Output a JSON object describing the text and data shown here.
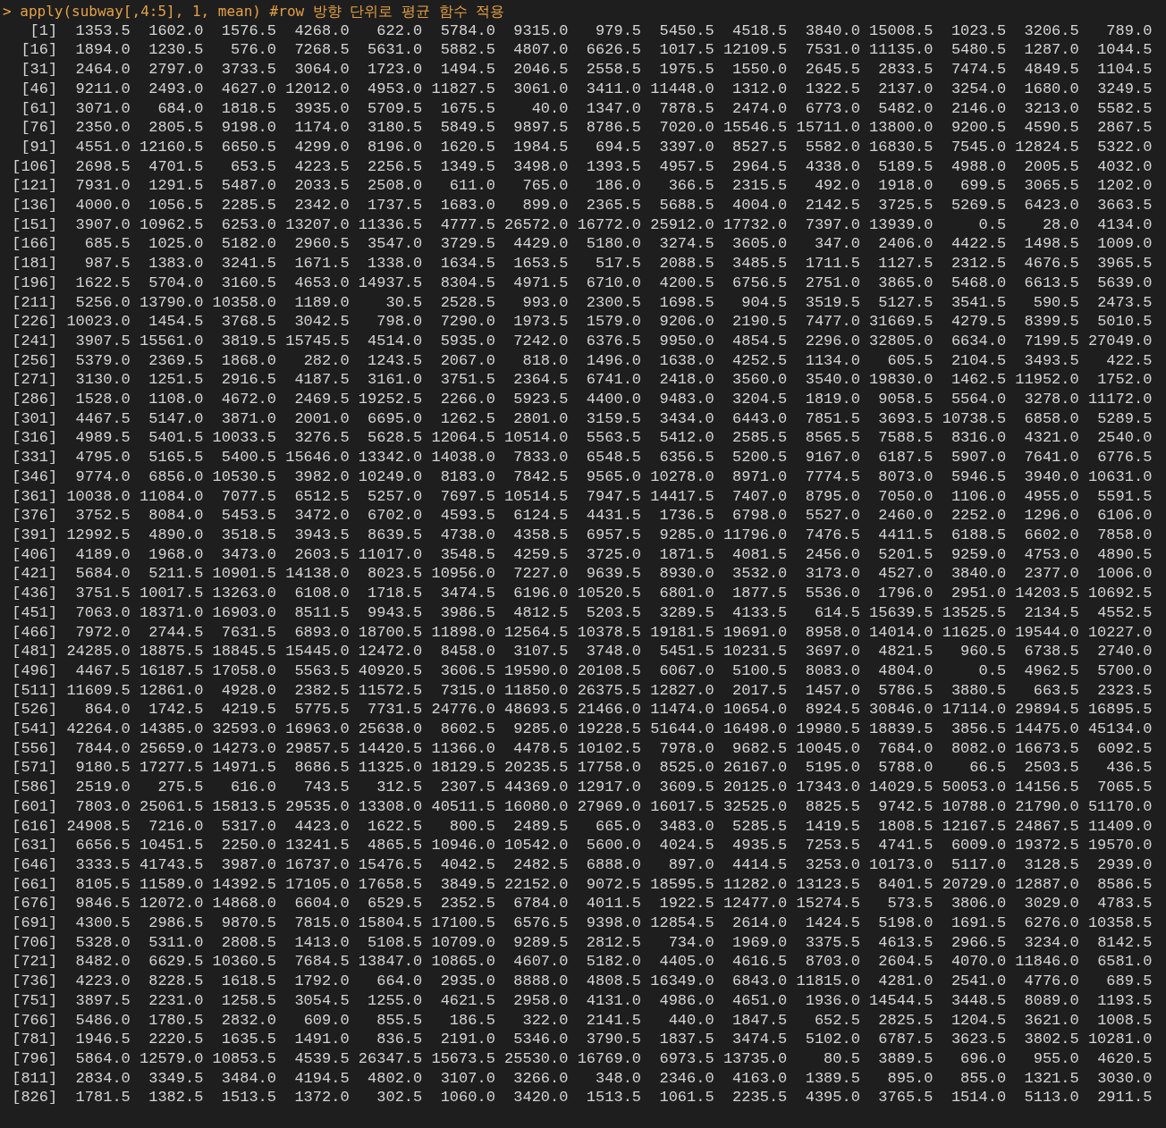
{
  "prompt": "> apply(subway[,4:5], 1, mean) #row 방향 단위로 평균 함수 적용",
  "rows": [
    {
      "index": "[1]",
      "values": [
        "1353.5",
        "1602.0",
        "1576.5",
        "4268.0",
        "622.0",
        "5784.0",
        "9315.0",
        "979.5",
        "5450.5",
        "4518.5",
        "3840.0",
        "15008.5",
        "1023.5",
        "3206.5",
        "789.0"
      ]
    },
    {
      "index": "[16]",
      "values": [
        "1894.0",
        "1230.5",
        "576.0",
        "7268.5",
        "5631.0",
        "5882.5",
        "4807.0",
        "6626.5",
        "1017.5",
        "12109.5",
        "7531.0",
        "11135.0",
        "5480.5",
        "1287.0",
        "1044.5"
      ]
    },
    {
      "index": "[31]",
      "values": [
        "2464.0",
        "2797.0",
        "3733.5",
        "3064.0",
        "1723.0",
        "1494.5",
        "2046.5",
        "2558.5",
        "1975.5",
        "1550.0",
        "2645.5",
        "2833.5",
        "7474.5",
        "4849.5",
        "1104.5"
      ]
    },
    {
      "index": "[46]",
      "values": [
        "9211.0",
        "2493.0",
        "4627.0",
        "12012.0",
        "4953.0",
        "11827.5",
        "3061.0",
        "3411.0",
        "11448.0",
        "1312.0",
        "1322.5",
        "2137.0",
        "3254.0",
        "1680.0",
        "3249.5"
      ]
    },
    {
      "index": "[61]",
      "values": [
        "3071.0",
        "684.0",
        "1818.5",
        "3935.0",
        "5709.5",
        "1675.5",
        "40.0",
        "1347.0",
        "7878.5",
        "2474.0",
        "6773.0",
        "5482.0",
        "2146.0",
        "3213.0",
        "5582.5"
      ]
    },
    {
      "index": "[76]",
      "values": [
        "2350.0",
        "2805.5",
        "9198.0",
        "1174.0",
        "3180.5",
        "5849.5",
        "9897.5",
        "8786.5",
        "7020.0",
        "15546.5",
        "15711.0",
        "13800.0",
        "9200.5",
        "4590.5",
        "2867.5"
      ]
    },
    {
      "index": "[91]",
      "values": [
        "4551.0",
        "12160.5",
        "6650.5",
        "4299.0",
        "8196.0",
        "1620.5",
        "1984.5",
        "694.5",
        "3397.0",
        "8527.5",
        "5582.0",
        "16830.5",
        "7545.0",
        "12824.5",
        "5322.0"
      ]
    },
    {
      "index": "[106]",
      "values": [
        "2698.5",
        "4701.5",
        "653.5",
        "4223.5",
        "2256.5",
        "1349.5",
        "3498.0",
        "1393.5",
        "4957.5",
        "2964.5",
        "4338.0",
        "5189.5",
        "4988.0",
        "2005.5",
        "4032.0"
      ]
    },
    {
      "index": "[121]",
      "values": [
        "7931.0",
        "1291.5",
        "5487.0",
        "2033.5",
        "2508.0",
        "611.0",
        "765.0",
        "186.0",
        "366.5",
        "2315.5",
        "492.0",
        "1918.0",
        "699.5",
        "3065.5",
        "1202.0"
      ]
    },
    {
      "index": "[136]",
      "values": [
        "4000.0",
        "1056.5",
        "2285.5",
        "2342.0",
        "1737.5",
        "1683.0",
        "899.0",
        "2365.5",
        "5688.5",
        "4004.0",
        "2142.5",
        "3725.5",
        "5269.5",
        "6423.0",
        "3663.5"
      ]
    },
    {
      "index": "[151]",
      "values": [
        "3907.0",
        "10962.5",
        "6253.0",
        "13207.0",
        "11336.5",
        "4777.5",
        "26572.0",
        "16772.0",
        "25912.0",
        "17732.0",
        "7397.0",
        "13939.0",
        "0.5",
        "28.0",
        "4134.0"
      ]
    },
    {
      "index": "[166]",
      "values": [
        "685.5",
        "1025.0",
        "5182.0",
        "2960.5",
        "3547.0",
        "3729.5",
        "4429.0",
        "5180.0",
        "3274.5",
        "3605.0",
        "347.0",
        "2406.0",
        "4422.5",
        "1498.5",
        "1009.0"
      ]
    },
    {
      "index": "[181]",
      "values": [
        "987.5",
        "1383.0",
        "3241.5",
        "1671.5",
        "1338.0",
        "1634.5",
        "1653.5",
        "517.5",
        "2088.5",
        "3485.5",
        "1711.5",
        "1127.5",
        "2312.5",
        "4676.5",
        "3965.5"
      ]
    },
    {
      "index": "[196]",
      "values": [
        "1622.5",
        "5704.0",
        "3160.5",
        "4653.0",
        "14937.5",
        "8304.5",
        "4971.5",
        "6710.0",
        "4200.5",
        "6756.5",
        "2751.0",
        "3865.0",
        "5468.0",
        "6613.5",
        "5639.0"
      ]
    },
    {
      "index": "[211]",
      "values": [
        "5256.0",
        "13790.0",
        "10358.0",
        "1189.0",
        "30.5",
        "2528.5",
        "993.0",
        "2300.5",
        "1698.5",
        "904.5",
        "3519.5",
        "5127.5",
        "3541.5",
        "590.5",
        "2473.5"
      ]
    },
    {
      "index": "[226]",
      "values": [
        "10023.0",
        "1454.5",
        "3768.5",
        "3042.5",
        "798.0",
        "7290.0",
        "1973.5",
        "1579.0",
        "9206.0",
        "2190.5",
        "7477.0",
        "31669.5",
        "4279.5",
        "8399.5",
        "5010.5"
      ]
    },
    {
      "index": "[241]",
      "values": [
        "3907.5",
        "15561.0",
        "3819.5",
        "15745.5",
        "4514.0",
        "5935.0",
        "7242.0",
        "6376.5",
        "9950.0",
        "4854.5",
        "2296.0",
        "32805.0",
        "6634.0",
        "7199.5",
        "27049.0"
      ]
    },
    {
      "index": "[256]",
      "values": [
        "5379.0",
        "2369.5",
        "1868.0",
        "282.0",
        "1243.5",
        "2067.0",
        "818.0",
        "1496.0",
        "1638.0",
        "4252.5",
        "1134.0",
        "605.5",
        "2104.5",
        "3493.5",
        "422.5"
      ]
    },
    {
      "index": "[271]",
      "values": [
        "3130.0",
        "1251.5",
        "2916.5",
        "4187.5",
        "3161.0",
        "3751.5",
        "2364.5",
        "6741.0",
        "2418.0",
        "3560.0",
        "3540.0",
        "19830.0",
        "1462.5",
        "11952.0",
        "1752.0"
      ]
    },
    {
      "index": "[286]",
      "values": [
        "1528.0",
        "1108.0",
        "4672.0",
        "2469.5",
        "19252.5",
        "2266.0",
        "5923.5",
        "4400.0",
        "9483.0",
        "3204.5",
        "1819.0",
        "9058.5",
        "5564.0",
        "3278.0",
        "11172.0"
      ]
    },
    {
      "index": "[301]",
      "values": [
        "4467.5",
        "5147.0",
        "3871.0",
        "2001.0",
        "6695.0",
        "1262.5",
        "2801.0",
        "3159.5",
        "3434.0",
        "6443.0",
        "7851.5",
        "3693.5",
        "10738.5",
        "6858.0",
        "5289.5"
      ]
    },
    {
      "index": "[316]",
      "values": [
        "4989.5",
        "5401.5",
        "10033.5",
        "3276.5",
        "5628.5",
        "12064.5",
        "10514.0",
        "5563.5",
        "5412.0",
        "2585.5",
        "8565.5",
        "7588.5",
        "8316.0",
        "4321.0",
        "2540.0"
      ]
    },
    {
      "index": "[331]",
      "values": [
        "4795.0",
        "5165.5",
        "5400.5",
        "15646.0",
        "13342.0",
        "14038.0",
        "7833.0",
        "6548.5",
        "6356.5",
        "5200.5",
        "9167.0",
        "6187.5",
        "5907.0",
        "7641.0",
        "6776.5"
      ]
    },
    {
      "index": "[346]",
      "values": [
        "9774.0",
        "6856.0",
        "10530.5",
        "3982.0",
        "10249.0",
        "8183.0",
        "7842.5",
        "9565.0",
        "10278.0",
        "8971.0",
        "7774.5",
        "8073.0",
        "5946.5",
        "3940.0",
        "10631.0"
      ]
    },
    {
      "index": "[361]",
      "values": [
        "10038.0",
        "11084.0",
        "7077.5",
        "6512.5",
        "5257.0",
        "7697.5",
        "10514.5",
        "7947.5",
        "14417.5",
        "7407.0",
        "8795.0",
        "7050.0",
        "1106.0",
        "4955.0",
        "5591.5"
      ]
    },
    {
      "index": "[376]",
      "values": [
        "3752.5",
        "8084.0",
        "5453.5",
        "3472.0",
        "6702.0",
        "4593.5",
        "6124.5",
        "4431.5",
        "1736.5",
        "6798.0",
        "5527.0",
        "2460.0",
        "2252.0",
        "1296.0",
        "6106.0"
      ]
    },
    {
      "index": "[391]",
      "values": [
        "12992.5",
        "4890.0",
        "3518.5",
        "3943.5",
        "8639.5",
        "4738.0",
        "4358.5",
        "6957.5",
        "9285.0",
        "11796.0",
        "7476.5",
        "4411.5",
        "6188.5",
        "6602.0",
        "7858.0"
      ]
    },
    {
      "index": "[406]",
      "values": [
        "4189.0",
        "1968.0",
        "3473.0",
        "2603.5",
        "11017.0",
        "3548.5",
        "4259.5",
        "3725.0",
        "1871.5",
        "4081.5",
        "2456.0",
        "5201.5",
        "9259.0",
        "4753.0",
        "4890.5"
      ]
    },
    {
      "index": "[421]",
      "values": [
        "5684.0",
        "5211.5",
        "10901.5",
        "14138.0",
        "8023.5",
        "10956.0",
        "7227.0",
        "9639.5",
        "8930.0",
        "3532.0",
        "3173.0",
        "4527.0",
        "3840.0",
        "2377.0",
        "1006.0"
      ]
    },
    {
      "index": "[436]",
      "values": [
        "3751.5",
        "10017.5",
        "13263.0",
        "6108.0",
        "1718.5",
        "3474.5",
        "6196.0",
        "10520.5",
        "6801.0",
        "1877.5",
        "5536.0",
        "1796.0",
        "2951.0",
        "14203.5",
        "10692.5"
      ]
    },
    {
      "index": "[451]",
      "values": [
        "7063.0",
        "18371.0",
        "16903.0",
        "8511.5",
        "9943.5",
        "3986.5",
        "4812.5",
        "5203.5",
        "3289.5",
        "4133.5",
        "614.5",
        "15639.5",
        "13525.5",
        "2134.5",
        "4552.5"
      ]
    },
    {
      "index": "[466]",
      "values": [
        "7972.0",
        "2744.5",
        "7631.5",
        "6893.0",
        "18700.5",
        "11898.0",
        "12564.5",
        "10378.5",
        "19181.5",
        "19691.0",
        "8958.0",
        "14014.0",
        "11625.0",
        "19544.0",
        "10227.0"
      ]
    },
    {
      "index": "[481]",
      "values": [
        "24285.0",
        "18875.5",
        "18845.5",
        "15445.0",
        "12472.0",
        "8458.0",
        "3107.5",
        "3748.0",
        "5451.5",
        "10231.5",
        "3697.0",
        "4821.5",
        "960.5",
        "6738.5",
        "2740.0"
      ]
    },
    {
      "index": "[496]",
      "values": [
        "4467.5",
        "16187.5",
        "17058.0",
        "5563.5",
        "40920.5",
        "3606.5",
        "19590.0",
        "20108.5",
        "6067.0",
        "5100.5",
        "8083.0",
        "4804.0",
        "0.5",
        "4962.5",
        "5700.0"
      ]
    },
    {
      "index": "[511]",
      "values": [
        "11609.5",
        "12861.0",
        "4928.0",
        "2382.5",
        "11572.5",
        "7315.0",
        "11850.0",
        "26375.5",
        "12827.0",
        "2017.5",
        "1457.0",
        "5786.5",
        "3880.5",
        "663.5",
        "2323.5"
      ]
    },
    {
      "index": "[526]",
      "values": [
        "864.0",
        "1742.5",
        "4219.5",
        "5775.5",
        "7731.5",
        "24776.0",
        "48693.5",
        "21466.0",
        "11474.0",
        "10654.0",
        "8924.5",
        "30846.0",
        "17114.0",
        "29894.5",
        "16895.5"
      ]
    },
    {
      "index": "[541]",
      "values": [
        "42264.0",
        "14385.0",
        "32593.0",
        "16963.0",
        "25638.0",
        "8602.5",
        "9285.0",
        "19228.5",
        "51644.0",
        "16498.0",
        "19980.5",
        "18839.5",
        "3856.5",
        "14475.0",
        "45134.0"
      ]
    },
    {
      "index": "[556]",
      "values": [
        "7844.0",
        "25659.0",
        "14273.0",
        "29857.5",
        "14420.5",
        "11366.0",
        "4478.5",
        "10102.5",
        "7978.0",
        "9682.5",
        "10045.0",
        "7684.0",
        "8082.0",
        "16673.5",
        "6092.5"
      ]
    },
    {
      "index": "[571]",
      "values": [
        "9180.5",
        "17277.5",
        "14971.5",
        "8686.5",
        "11325.0",
        "18129.5",
        "20235.5",
        "17758.0",
        "8525.0",
        "26167.0",
        "5195.0",
        "5788.0",
        "66.5",
        "2503.5",
        "436.5"
      ]
    },
    {
      "index": "[586]",
      "values": [
        "2519.0",
        "275.5",
        "616.0",
        "743.5",
        "312.5",
        "2307.5",
        "44369.0",
        "12917.0",
        "3609.5",
        "20125.0",
        "17343.0",
        "14029.5",
        "50053.0",
        "14156.5",
        "7065.5"
      ]
    },
    {
      "index": "[601]",
      "values": [
        "7803.0",
        "25061.5",
        "15813.5",
        "29535.0",
        "13308.0",
        "40511.5",
        "16080.0",
        "27969.0",
        "16017.5",
        "32525.0",
        "8825.5",
        "9742.5",
        "10788.0",
        "21790.0",
        "51170.0"
      ]
    },
    {
      "index": "[616]",
      "values": [
        "24908.5",
        "7216.0",
        "5317.0",
        "4423.0",
        "1622.5",
        "800.5",
        "2489.5",
        "665.0",
        "3483.0",
        "5285.5",
        "1419.5",
        "1808.5",
        "12167.5",
        "24867.5",
        "11409.0"
      ]
    },
    {
      "index": "[631]",
      "values": [
        "6656.5",
        "10451.5",
        "2250.0",
        "13241.5",
        "4865.5",
        "10946.0",
        "10542.0",
        "5600.0",
        "4024.5",
        "4935.5",
        "7253.5",
        "4741.5",
        "6009.0",
        "19372.5",
        "19570.0"
      ]
    },
    {
      "index": "[646]",
      "values": [
        "3333.5",
        "41743.5",
        "3987.0",
        "16737.0",
        "15476.5",
        "4042.5",
        "2482.5",
        "6888.0",
        "897.0",
        "4414.5",
        "3253.0",
        "10173.0",
        "5117.0",
        "3128.5",
        "2939.0"
      ]
    },
    {
      "index": "[661]",
      "values": [
        "8105.5",
        "11589.0",
        "14392.5",
        "17105.0",
        "17658.5",
        "3849.5",
        "22152.0",
        "9072.5",
        "18595.5",
        "11282.0",
        "13123.5",
        "8401.5",
        "20729.0",
        "12887.0",
        "8586.5"
      ]
    },
    {
      "index": "[676]",
      "values": [
        "9846.5",
        "12072.0",
        "14868.0",
        "6604.0",
        "6529.5",
        "2352.5",
        "6784.0",
        "4011.5",
        "1922.5",
        "12477.0",
        "15274.5",
        "573.5",
        "3806.0",
        "3029.0",
        "4783.5"
      ]
    },
    {
      "index": "[691]",
      "values": [
        "4300.5",
        "2986.5",
        "9870.5",
        "7815.0",
        "15804.5",
        "17100.5",
        "6576.5",
        "9398.0",
        "12854.5",
        "2614.0",
        "1424.5",
        "5198.0",
        "1691.5",
        "6276.0",
        "10358.5"
      ]
    },
    {
      "index": "[706]",
      "values": [
        "5328.0",
        "5311.0",
        "2808.5",
        "1413.0",
        "5108.5",
        "10709.0",
        "9289.5",
        "2812.5",
        "734.0",
        "1969.0",
        "3375.5",
        "4613.5",
        "2966.5",
        "3234.0",
        "8142.5"
      ]
    },
    {
      "index": "[721]",
      "values": [
        "8482.0",
        "6629.5",
        "10360.5",
        "7684.5",
        "13847.0",
        "10865.0",
        "4607.0",
        "5182.0",
        "4405.0",
        "4616.5",
        "8703.0",
        "2604.5",
        "4070.0",
        "11846.0",
        "6581.0"
      ]
    },
    {
      "index": "[736]",
      "values": [
        "4223.0",
        "8228.5",
        "1618.5",
        "1792.0",
        "664.0",
        "2935.0",
        "8888.0",
        "4808.5",
        "16349.0",
        "6843.0",
        "11815.0",
        "4281.0",
        "2541.0",
        "4776.0",
        "689.5"
      ]
    },
    {
      "index": "[751]",
      "values": [
        "3897.5",
        "2231.0",
        "1258.5",
        "3054.5",
        "1255.0",
        "4621.5",
        "2958.0",
        "4131.0",
        "4986.0",
        "4651.0",
        "1936.0",
        "14544.5",
        "3448.5",
        "8089.0",
        "1193.5"
      ]
    },
    {
      "index": "[766]",
      "values": [
        "5486.0",
        "1780.5",
        "2832.0",
        "609.0",
        "855.5",
        "186.5",
        "322.0",
        "2141.5",
        "440.0",
        "1847.5",
        "652.5",
        "2825.5",
        "1204.5",
        "3621.0",
        "1008.5"
      ]
    },
    {
      "index": "[781]",
      "values": [
        "1946.5",
        "2220.5",
        "1635.5",
        "1491.0",
        "836.5",
        "2191.0",
        "5346.0",
        "3790.5",
        "1837.5",
        "3474.5",
        "5102.0",
        "6787.5",
        "3623.5",
        "3802.5",
        "10281.0"
      ]
    },
    {
      "index": "[796]",
      "values": [
        "5864.0",
        "12579.0",
        "10853.5",
        "4539.5",
        "26347.5",
        "15673.5",
        "25530.0",
        "16769.0",
        "6973.5",
        "13735.0",
        "80.5",
        "3889.5",
        "696.0",
        "955.0",
        "4620.5"
      ]
    },
    {
      "index": "[811]",
      "values": [
        "2834.0",
        "3349.5",
        "3484.0",
        "4194.5",
        "4802.0",
        "3107.0",
        "3266.0",
        "348.0",
        "2346.0",
        "4163.0",
        "1389.5",
        "895.0",
        "855.0",
        "1321.5",
        "3030.0"
      ]
    },
    {
      "index": "[826]",
      "values": [
        "1781.5",
        "1382.5",
        "1513.5",
        "1372.0",
        "302.5",
        "1060.0",
        "3420.0",
        "1513.5",
        "1061.5",
        "2235.5",
        "4395.0",
        "3765.5",
        "1514.0",
        "5113.0",
        "2911.5"
      ]
    }
  ]
}
